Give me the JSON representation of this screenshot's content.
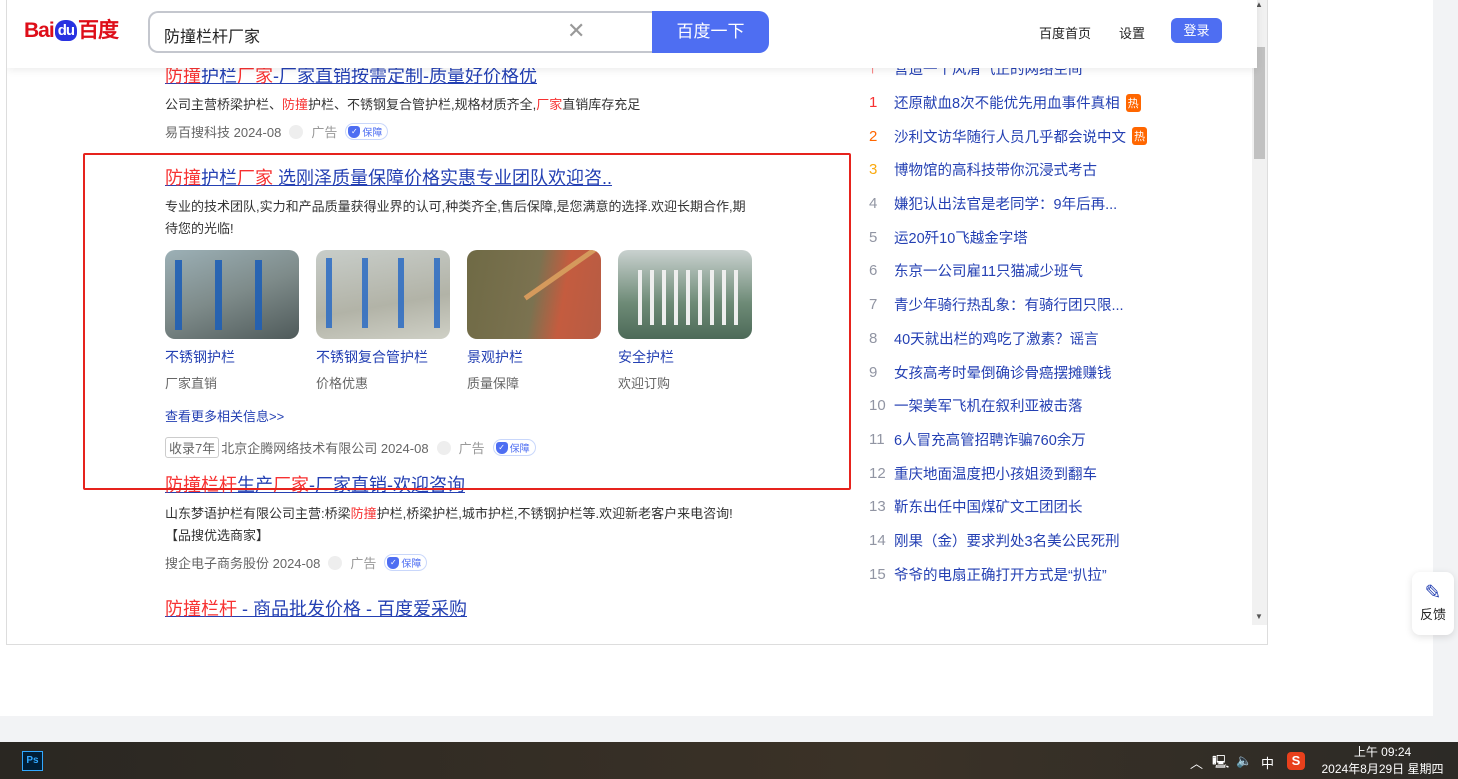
{
  "header": {
    "logo": "Baidu百度",
    "query": "防撞栏杆厂家",
    "search_button": "百度一下",
    "home": "百度首页",
    "settings": "设置",
    "login": "登录"
  },
  "results": [
    {
      "title_parts": [
        {
          "t": "防撞",
          "r": true
        },
        {
          "t": "护栏",
          "r": false
        },
        {
          "t": "厂家",
          "r": true
        },
        {
          "t": "-厂家直销按需定制-质量好价格优",
          "r": false
        }
      ],
      "desc_parts": [
        {
          "t": "公司主营桥梁护栏、",
          "r": false
        },
        {
          "t": "防撞",
          "r": true
        },
        {
          "t": "护栏、不锈钢复合管护栏,规格材质齐全,",
          "r": false
        },
        {
          "t": "厂家",
          "r": true
        },
        {
          "t": "直销库存充足",
          "r": false
        }
      ],
      "source": "易百搜科技 2024-08",
      "ad": "广告",
      "badge": "保障"
    },
    {
      "title_parts": [
        {
          "t": "防撞",
          "r": true
        },
        {
          "t": "护栏",
          "r": false
        },
        {
          "t": "厂家",
          "r": true
        },
        {
          "t": " 选刚泽质量保障价格实惠专业团队欢迎咨..",
          "r": false
        }
      ],
      "desc": "专业的技术团队,实力和产品质量获得业界的认可,种类齐全,售后保障,是您满意的选择.欢迎长期合作,期待您的光临!",
      "images": [
        {
          "label": "不锈钢护栏",
          "sub": "厂家直销"
        },
        {
          "label": "不锈钢复合管护栏",
          "sub": "价格优惠"
        },
        {
          "label": "景观护栏",
          "sub": "质量保障"
        },
        {
          "label": "安全护栏",
          "sub": "欢迎订购"
        }
      ],
      "more": "查看更多相关信息>>",
      "tag": "收录7年",
      "source": "北京企腾网络技术有限公司 2024-08",
      "ad": "广告",
      "badge": "保障"
    },
    {
      "title_parts": [
        {
          "t": "防撞栏杆",
          "r": true
        },
        {
          "t": "生产",
          "r": false
        },
        {
          "t": "厂家",
          "r": true
        },
        {
          "t": "-厂家直销-欢迎咨询",
          "r": false
        }
      ],
      "desc_parts": [
        {
          "t": "山东梦语护栏有限公司主营:桥梁",
          "r": false
        },
        {
          "t": "防撞",
          "r": true
        },
        {
          "t": "护栏,桥梁护栏,城市护栏,不锈钢护栏等.欢迎新老客户来电咨询!【品搜优选商家】",
          "r": false
        }
      ],
      "source": "搜企电子商务股份  2024-08",
      "ad": "广告",
      "badge": "保障"
    },
    {
      "title_parts": [
        {
          "t": "防撞栏杆",
          "r": true
        },
        {
          "t": " - 商品批发价格 - 百度爱采购",
          "r": false
        }
      ]
    }
  ],
  "hot": {
    "top": "营造一个风清气正的网络空间",
    "items": [
      {
        "n": "1",
        "t": "还原献血8次不能优先用血事件真相",
        "hot": "热"
      },
      {
        "n": "2",
        "t": "沙利文访华随行人员几乎都会说中文",
        "hot": "热"
      },
      {
        "n": "3",
        "t": "博物馆的高科技带你沉浸式考古"
      },
      {
        "n": "4",
        "t": "嫌犯认出法官是老同学：9年后再..."
      },
      {
        "n": "5",
        "t": "运20歼10飞越金字塔"
      },
      {
        "n": "6",
        "t": "东京一公司雇11只猫减少班气"
      },
      {
        "n": "7",
        "t": "青少年骑行热乱象：有骑行团只限..."
      },
      {
        "n": "8",
        "t": "40天就出栏的鸡吃了激素？谣言"
      },
      {
        "n": "9",
        "t": "女孩高考时晕倒确诊骨癌摆摊赚钱"
      },
      {
        "n": "10",
        "t": "一架美军飞机在叙利亚被击落"
      },
      {
        "n": "11",
        "t": "6人冒充高管招聘诈骗760余万"
      },
      {
        "n": "12",
        "t": "重庆地面温度把小孩姐烫到翻车"
      },
      {
        "n": "13",
        "t": "靳东出任中国煤矿文工团团长"
      },
      {
        "n": "14",
        "t": "刚果（金）要求判处3名美公民死刑"
      },
      {
        "n": "15",
        "t": "爷爷的电扇正确打开方式是“扒拉”"
      }
    ]
  },
  "feedback": "反馈",
  "taskbar": {
    "ps": "Ps",
    "ime": "中",
    "sogou": "S",
    "time": "上午 09:24",
    "date": "2024年8月29日 星期四"
  },
  "colors": {
    "accent": "#4e6ef2",
    "link": "#2440b3",
    "highlight": "#f73131",
    "box": "#e6231d"
  }
}
